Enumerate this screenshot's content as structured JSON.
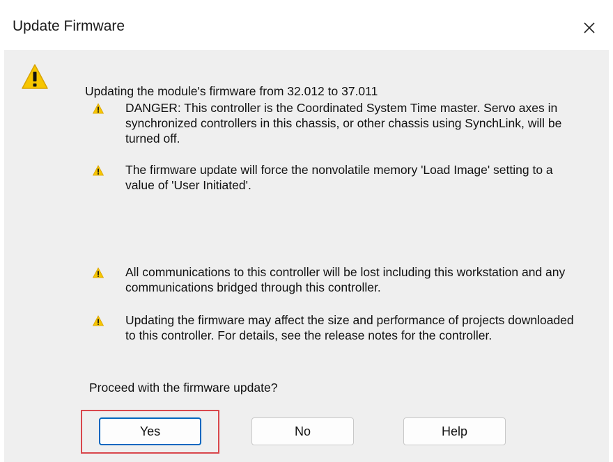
{
  "window": {
    "title": "Update Firmware",
    "close_icon": "close-icon"
  },
  "main": {
    "icon": "warning-icon",
    "heading": "Updating the module's firmware from 32.012 to 37.011",
    "warnings": [
      {
        "icon": "warning-icon",
        "text": "DANGER: This controller is the Coordinated System Time master. Servo axes in synchronized controllers in this chassis, or other chassis using SynchLink, will be turned off."
      },
      {
        "icon": "warning-icon",
        "text": "The firmware update will force the nonvolatile memory 'Load Image' setting to a value of 'User Initiated'."
      },
      {
        "icon": "warning-icon",
        "text": "All communications to this controller will be lost including this workstation and any communications bridged through this controller."
      },
      {
        "icon": "warning-icon",
        "text": "Updating the firmware may affect the size and performance of projects downloaded to this controller.  For details, see the release notes for the controller."
      }
    ],
    "prompt": "Proceed with the firmware update?"
  },
  "buttons": {
    "yes": "Yes",
    "no": "No",
    "help": "Help"
  },
  "colors": {
    "warning_yellow": "#f7c600",
    "focus_blue": "#0067c0",
    "highlight_red": "#d9474c"
  }
}
